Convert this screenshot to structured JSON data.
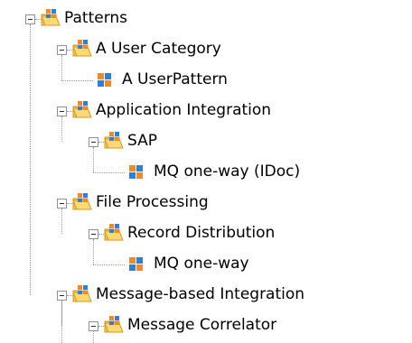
{
  "tree": {
    "nodes": [
      {
        "label": "Patterns",
        "level": 0,
        "type": "folder",
        "expanded": true,
        "toggle-icon": "collapse-minus-icon",
        "icon": "folder-pattern-icon"
      },
      {
        "label": "A User Category",
        "level": 1,
        "type": "folder",
        "expanded": true,
        "toggle-icon": "collapse-minus-icon",
        "icon": "folder-pattern-icon"
      },
      {
        "label": "A UserPattern",
        "level": 2,
        "type": "pattern",
        "icon": "pattern-icon"
      },
      {
        "label": "Application Integration",
        "level": 1,
        "type": "folder",
        "expanded": true,
        "toggle-icon": "collapse-minus-icon",
        "icon": "folder-pattern-icon"
      },
      {
        "label": "SAP",
        "level": 2,
        "type": "folder",
        "expanded": true,
        "toggle-icon": "collapse-minus-icon",
        "icon": "folder-pattern-icon"
      },
      {
        "label": "MQ one-way (IDoc)",
        "level": 3,
        "type": "pattern",
        "icon": "pattern-icon"
      },
      {
        "label": "File Processing",
        "level": 1,
        "type": "folder",
        "expanded": true,
        "toggle-icon": "collapse-minus-icon",
        "icon": "folder-pattern-icon"
      },
      {
        "label": "Record Distribution",
        "level": 2,
        "type": "folder",
        "expanded": true,
        "toggle-icon": "collapse-minus-icon",
        "icon": "folder-pattern-icon"
      },
      {
        "label": "MQ one-way",
        "level": 3,
        "type": "pattern",
        "icon": "pattern-icon"
      },
      {
        "label": "Message-based Integration",
        "level": 1,
        "type": "folder",
        "expanded": true,
        "toggle-icon": "collapse-minus-icon",
        "icon": "folder-pattern-icon"
      },
      {
        "label": "Message Correlator",
        "level": 2,
        "type": "folder",
        "expanded": true,
        "toggle-icon": "collapse-minus-icon",
        "icon": "folder-pattern-icon"
      }
    ]
  },
  "colors": {
    "folder": "#f5c24a",
    "folder_dark": "#d49a1c",
    "pattern_orange": "#f08a24",
    "pattern_blue": "#2f7fd8",
    "connector": "#9a9a9a"
  }
}
